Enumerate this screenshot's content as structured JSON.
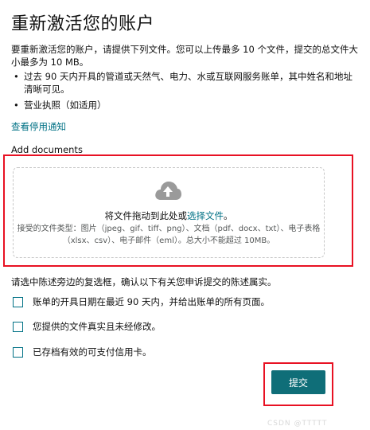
{
  "page": {
    "title": "重新激活您的账户",
    "intro": "要重新激活您的账户，请提供下列文件。您可以上传最多 10 个文件，提交的总文件大小最多为 10 MB。",
    "bullets": [
      "过去 90 天内开具的管道或天然气、电力、水或互联网服务账单，其中姓名和地址清晰可见。",
      "营业执照（如适用）"
    ],
    "bullet_symbol": "•",
    "notice_link": "查看停用通知"
  },
  "upload": {
    "label": "Add documents",
    "icon": "cloud-upload-icon",
    "drag_text": "将文件拖动到此处或",
    "choose_link": "选择文件",
    "drag_suffix": "。",
    "accepted_types": "接受的文件类型：图片（jpeg、gif、tiff、png）、文档（pdf、docx、txt）、电子表格（xlsx、csv）、电子邮件（eml）。总大小不能超过 10MB。"
  },
  "confirm": {
    "instruction": "请选中陈述旁边的复选框，确认以下有关您申诉提交的陈述属实。",
    "items": [
      "账单的开具日期在最近 90 天内，并给出账单的所有页面。",
      "您提供的文件真实且未经修改。",
      "已存档有效的可支付信用卡。"
    ]
  },
  "actions": {
    "submit_label": "提交"
  },
  "watermark": "CSDN @TTTTT",
  "colors": {
    "accent": "#007185",
    "button": "#0f6e78",
    "highlight": "#e81123",
    "text": "#111111",
    "muted": "#565959"
  }
}
